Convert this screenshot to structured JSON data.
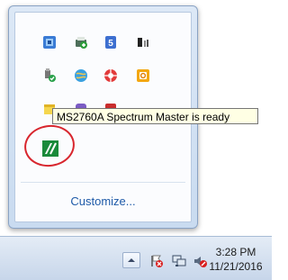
{
  "tooltip": {
    "text": "MS2760A Spectrum Master is ready"
  },
  "flyout": {
    "customize_label": "Customize...",
    "icons": [
      {
        "name": "keyboard-layout-icon"
      },
      {
        "name": "printer-status-icon"
      },
      {
        "name": "html5-shield-icon"
      },
      {
        "name": "device-manager-icon"
      },
      {
        "name": "usb-safely-remove-icon"
      },
      {
        "name": "network-globe-icon"
      },
      {
        "name": "security-app-icon"
      },
      {
        "name": "office-upload-icon"
      },
      {
        "name": "notes-icon"
      },
      {
        "name": "bluetooth-app-icon"
      },
      {
        "name": "red-tool-icon"
      },
      {
        "name": "spectrum-master-icon"
      }
    ]
  },
  "taskbar": {
    "show_hidden_icons": "show-hidden-icons-up-arrow",
    "tray_icons": [
      "action-center-flag-icon",
      "network-monitor-icon",
      "volume-muted-icon"
    ],
    "time": "3:28 PM",
    "date": "11/21/2016"
  },
  "colors": {
    "flyout_border": "#8aa3c4",
    "link": "#1e5aa8",
    "highlight": "#d8262e",
    "tooltip_bg": "#ffffe4"
  }
}
